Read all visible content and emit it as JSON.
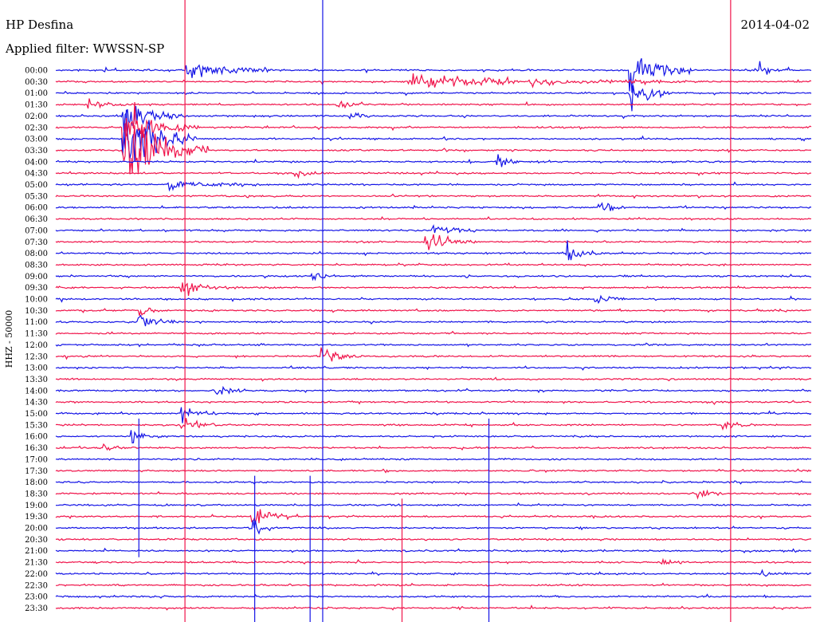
{
  "header": {
    "station": "HP Desfina",
    "filter": "Applied filter: WWSSN-SP",
    "date": "2014-04-02",
    "channel_label": "HHZ - 50000"
  },
  "colors": {
    "blue": "#1414e6",
    "red": "#f0144b",
    "background": "#ffffff",
    "text": "#000000"
  },
  "chart_data": {
    "type": "line",
    "title": "HP Desfina",
    "subtitle": "Applied filter: WWSSN-SP",
    "ylabel": "HHZ - 50000",
    "time_labels": [
      "00:00",
      "00:30",
      "01:00",
      "01:30",
      "02:00",
      "02:30",
      "03:00",
      "03:30",
      "04:00",
      "04:30",
      "05:00",
      "05:30",
      "06:00",
      "06:30",
      "07:00",
      "07:30",
      "08:00",
      "08:30",
      "09:00",
      "09:30",
      "10:00",
      "10:30",
      "11:00",
      "11:30",
      "12:00",
      "12:30",
      "13:00",
      "13:30",
      "14:00",
      "14:30",
      "15:00",
      "15:30",
      "16:00",
      "16:30",
      "17:00",
      "17:30",
      "18:00",
      "18:30",
      "19:00",
      "19:30",
      "20:00",
      "20:30",
      "21:00",
      "21:30",
      "22:00",
      "22:30",
      "23:00",
      "23:30"
    ],
    "trace_minutes": 30,
    "trace_colors_alternate": [
      "blue",
      "red"
    ],
    "grid": false,
    "events": [
      {
        "row": 0,
        "t": 5.2,
        "amp": 2.0,
        "dur": 3.5,
        "color": "red"
      },
      {
        "row": 0,
        "t": 22.8,
        "amp": 7.0,
        "dur": 2.5,
        "color": "blue"
      },
      {
        "row": 0,
        "t": 28.0,
        "amp": 1.2,
        "dur": 1.2,
        "color": "blue"
      },
      {
        "row": 1,
        "t": 14.0,
        "amp": 1.5,
        "dur": 12.0,
        "color": "red"
      },
      {
        "row": 2,
        "t": 22.8,
        "amp": 3.0,
        "dur": 2.0,
        "color": "blue"
      },
      {
        "row": 3,
        "t": 1.3,
        "amp": 1.5,
        "dur": 1.5,
        "color": "red"
      },
      {
        "row": 3,
        "t": 11.2,
        "amp": 1.2,
        "dur": 1.0,
        "color": "red"
      },
      {
        "row": 4,
        "t": 2.7,
        "amp": 4.0,
        "dur": 2.5,
        "color": "blue"
      },
      {
        "row": 4,
        "t": 11.6,
        "amp": 2.2,
        "dur": 1.0,
        "color": "blue"
      },
      {
        "row": 5,
        "t": 2.7,
        "amp": 6.0,
        "dur": 3.0,
        "color": "blue"
      },
      {
        "row": 6,
        "t": 2.7,
        "amp": 9.0,
        "dur": 3.0,
        "color": "blue"
      },
      {
        "row": 7,
        "t": 2.7,
        "amp": 12.0,
        "dur": 3.5,
        "color": "blue"
      },
      {
        "row": 8,
        "t": 17.5,
        "amp": 2.0,
        "dur": 1.0,
        "color": "blue"
      },
      {
        "row": 9,
        "t": 9.5,
        "amp": 1.5,
        "dur": 1.2,
        "color": "red"
      },
      {
        "row": 10,
        "t": 4.5,
        "amp": 1.2,
        "dur": 4.0,
        "color": "blue"
      },
      {
        "row": 12,
        "t": 21.6,
        "amp": 2.0,
        "dur": 1.0,
        "color": "blue"
      },
      {
        "row": 14,
        "t": 15.0,
        "amp": 1.8,
        "dur": 1.5,
        "color": "blue"
      },
      {
        "row": 15,
        "t": 14.7,
        "amp": 2.0,
        "dur": 2.0,
        "color": "red"
      },
      {
        "row": 16,
        "t": 20.3,
        "amp": 2.5,
        "dur": 1.5,
        "color": "red"
      },
      {
        "row": 18,
        "t": 10.2,
        "amp": 1.2,
        "dur": 1.0,
        "color": "blue"
      },
      {
        "row": 19,
        "t": 5.0,
        "amp": 1.5,
        "dur": 2.5,
        "color": "red"
      },
      {
        "row": 20,
        "t": 21.4,
        "amp": 2.0,
        "dur": 1.2,
        "color": "blue"
      },
      {
        "row": 21,
        "t": 3.3,
        "amp": 1.3,
        "dur": 1.0,
        "color": "red"
      },
      {
        "row": 22,
        "t": 3.3,
        "amp": 2.0,
        "dur": 1.8,
        "color": "blue"
      },
      {
        "row": 25,
        "t": 10.5,
        "amp": 2.5,
        "dur": 1.8,
        "color": "red"
      },
      {
        "row": 28,
        "t": 6.4,
        "amp": 1.2,
        "dur": 1.5,
        "color": "blue"
      },
      {
        "row": 30,
        "t": 5.0,
        "amp": 2.0,
        "dur": 1.5,
        "color": "blue"
      },
      {
        "row": 31,
        "t": 5.0,
        "amp": 1.6,
        "dur": 1.5,
        "color": "red"
      },
      {
        "row": 31,
        "t": 26.5,
        "amp": 1.3,
        "dur": 1.2,
        "color": "red"
      },
      {
        "row": 32,
        "t": 3.0,
        "amp": 1.5,
        "dur": 1.5,
        "color": "blue"
      },
      {
        "row": 33,
        "t": 1.9,
        "amp": 1.2,
        "dur": 1.0,
        "color": "red"
      },
      {
        "row": 37,
        "t": 25.5,
        "amp": 1.2,
        "dur": 1.5,
        "color": "red"
      },
      {
        "row": 39,
        "t": 7.8,
        "amp": 3.0,
        "dur": 1.5,
        "color": "red"
      },
      {
        "row": 40,
        "t": 7.8,
        "amp": 1.8,
        "dur": 1.2,
        "color": "blue"
      },
      {
        "row": 43,
        "t": 24.0,
        "amp": 1.0,
        "dur": 1.2,
        "color": "red"
      },
      {
        "row": 44,
        "t": 28.0,
        "amp": 1.0,
        "dur": 1.0,
        "color": "blue"
      }
    ],
    "spikes": [
      {
        "t": 5.13,
        "rows": [
          0,
          47
        ],
        "color": "red"
      },
      {
        "t": 10.6,
        "rows": [
          0,
          47
        ],
        "color": "blue"
      },
      {
        "t": 26.8,
        "rows": [
          0,
          47
        ],
        "color": "red"
      },
      {
        "t": 7.9,
        "rows": [
          36,
          47
        ],
        "color": "blue"
      },
      {
        "t": 10.1,
        "rows": [
          36,
          47
        ],
        "color": "blue"
      },
      {
        "t": 13.75,
        "rows": [
          38,
          47
        ],
        "color": "red"
      },
      {
        "t": 17.2,
        "rows": [
          31,
          47
        ],
        "color": "blue"
      },
      {
        "t": 3.3,
        "rows": [
          31,
          42
        ],
        "color": "blue"
      }
    ]
  }
}
